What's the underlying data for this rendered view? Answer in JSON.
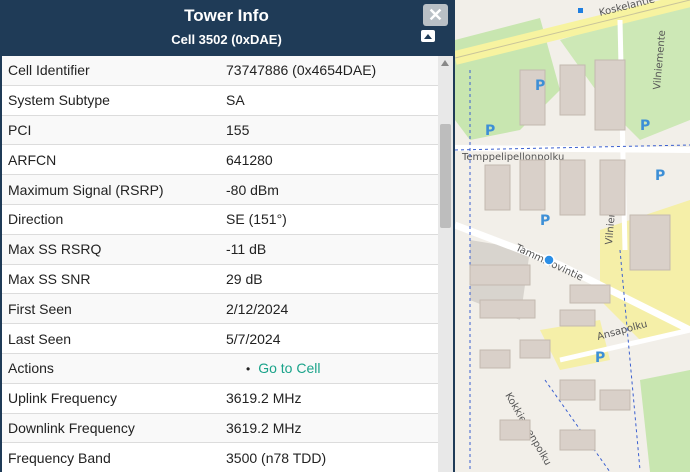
{
  "panel": {
    "title": "Tower Info",
    "subtitle": "Cell 3502 (0xDAE)",
    "close_label": "✕",
    "rows": [
      {
        "label": "Cell Identifier",
        "value": "73747886 (0x4654DAE)"
      },
      {
        "label": "System Subtype",
        "value": "SA"
      },
      {
        "label": "PCI",
        "value": "155"
      },
      {
        "label": "ARFCN",
        "value": "641280"
      },
      {
        "label": "Maximum Signal (RSRP)",
        "value": "-80 dBm"
      },
      {
        "label": "Direction",
        "value": "SE (151°)"
      },
      {
        "label": "Max SS RSRQ",
        "value": "-11 dB"
      },
      {
        "label": "Max SS SNR",
        "value": "29 dB"
      },
      {
        "label": "First Seen",
        "value": "2/12/2024"
      },
      {
        "label": "Last Seen",
        "value": "5/7/2024"
      },
      {
        "label": "Actions",
        "link": "Go to Cell"
      },
      {
        "label": "Uplink Frequency",
        "value": "3619.2 MHz"
      },
      {
        "label": "Downlink Frequency",
        "value": "3619.2 MHz"
      },
      {
        "label": "Frequency Band",
        "value": "3500 (n78 TDD)"
      }
    ]
  },
  "map": {
    "streets": [
      "Koskelantie",
      "Vilniemente",
      "Temppelipellonpolku",
      "Vilniementie",
      "Tammihovintie",
      "Ansapolku",
      "Kokkiemenpolku"
    ],
    "parking_label": "P",
    "colors": {
      "park": "#c8e6b0",
      "road": "#ffffff",
      "building": "#d9d0c9",
      "link": "#1aa38a",
      "marker": "#2b8ee6"
    }
  }
}
